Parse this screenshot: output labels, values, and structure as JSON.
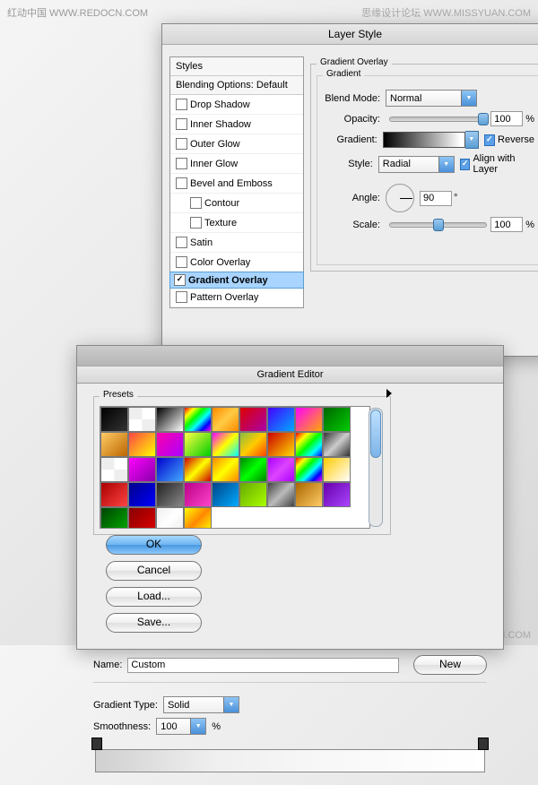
{
  "watermarks": {
    "tl": "红动中国 WWW.REDOCN.COM",
    "tr": "思缘设计论坛 WWW.MISSYUAN.COM",
    "br": "红动中国 WWW.REDOCN.COM"
  },
  "layerStyle": {
    "title": "Layer Style",
    "sidebar": {
      "styles": "Styles",
      "blending": "Blending Options: Default",
      "items": [
        "Drop Shadow",
        "Inner Shadow",
        "Outer Glow",
        "Inner Glow",
        "Bevel and Emboss",
        "Contour",
        "Texture",
        "Satin",
        "Color Overlay",
        "Gradient Overlay",
        "Pattern Overlay"
      ]
    },
    "panel": {
      "groupTitle": "Gradient Overlay",
      "subTitle": "Gradient",
      "blendMode": {
        "label": "Blend Mode:",
        "value": "Normal"
      },
      "opacity": {
        "label": "Opacity:",
        "value": "100",
        "unit": "%"
      },
      "gradient": {
        "label": "Gradient:",
        "reverse": "Reverse"
      },
      "style": {
        "label": "Style:",
        "value": "Radial",
        "align": "Align with Layer"
      },
      "angle": {
        "label": "Angle:",
        "value": "90",
        "unit": "°"
      },
      "scale": {
        "label": "Scale:",
        "value": "100",
        "unit": "%"
      }
    }
  },
  "gradientEditor": {
    "title": "Gradient Editor",
    "presets": "Presets",
    "buttons": {
      "ok": "OK",
      "cancel": "Cancel",
      "load": "Load...",
      "save": "Save..."
    },
    "name": {
      "label": "Name:",
      "value": "Custom"
    },
    "newBtn": "New",
    "type": {
      "label": "Gradient Type:",
      "value": "Solid"
    },
    "smooth": {
      "label": "Smoothness:",
      "value": "100",
      "unit": "%"
    },
    "presetSwatches": [
      "linear-gradient(135deg,#000,#333)",
      "repeating-conic-gradient(#fff 0 25%,#eee 0 50%)",
      "linear-gradient(135deg,#000,#fff)",
      "linear-gradient(135deg,red,#ff0,#0f0,#0ff,#00f,#f0f)",
      "linear-gradient(135deg,#f80,#fc4,#f80)",
      "linear-gradient(135deg,#d00,#a0a)",
      "linear-gradient(135deg,#40f,#0af)",
      "linear-gradient(135deg,#f0f,#fa0)",
      "linear-gradient(135deg,#060,#0c0)",
      "linear-gradient(135deg,#fc6,#b60)",
      "linear-gradient(135deg,#f44,#ff0)",
      "linear-gradient(135deg,#f0a,#a0f)",
      "linear-gradient(135deg,#ff4,#0c0)",
      "linear-gradient(135deg,#f0f,#ff0,#0ff)",
      "linear-gradient(135deg,#8b4,#fc0,#f40)",
      "linear-gradient(135deg,#c00,#fd0)",
      "linear-gradient(135deg,red,#ff0,#0f0,#0ff,#00f)",
      "linear-gradient(135deg,#333,#ccc,#333)",
      "repeating-conic-gradient(#fff 0 25%,#eee 0 50%)",
      "linear-gradient(135deg,#f0f,#80a)",
      "linear-gradient(135deg,#00c,#4af)",
      "linear-gradient(135deg,#c00,#ff0,#c00)",
      "linear-gradient(135deg,#f80,#ff0,#f80)",
      "linear-gradient(135deg,#080,#0f0,#080)",
      "linear-gradient(135deg,#a0f,#d4f,#a0f)",
      "linear-gradient(135deg,red,#ff0,#0f0,#0ff,#00f,#f0f)",
      "linear-gradient(135deg,#fc0,#fff)",
      "linear-gradient(135deg,#a00,#f44)",
      "linear-gradient(135deg,#008,#00f)",
      "linear-gradient(135deg,#222,#888)",
      "linear-gradient(135deg,#b08,#f4c)",
      "linear-gradient(135deg,#048,#0af)",
      "linear-gradient(135deg,#6a0,#af0)",
      "linear-gradient(135deg,#444,#bbb,#444)",
      "linear-gradient(135deg,#a60,#fc6)",
      "linear-gradient(135deg,#60a,#a4f)",
      "linear-gradient(135deg,#040,#0a0)",
      "linear-gradient(135deg,#800,#d00)",
      "linear-gradient(135deg,#eee,#fff,#eee)",
      "linear-gradient(135deg,#ff0,#f80,#ff0)"
    ]
  }
}
